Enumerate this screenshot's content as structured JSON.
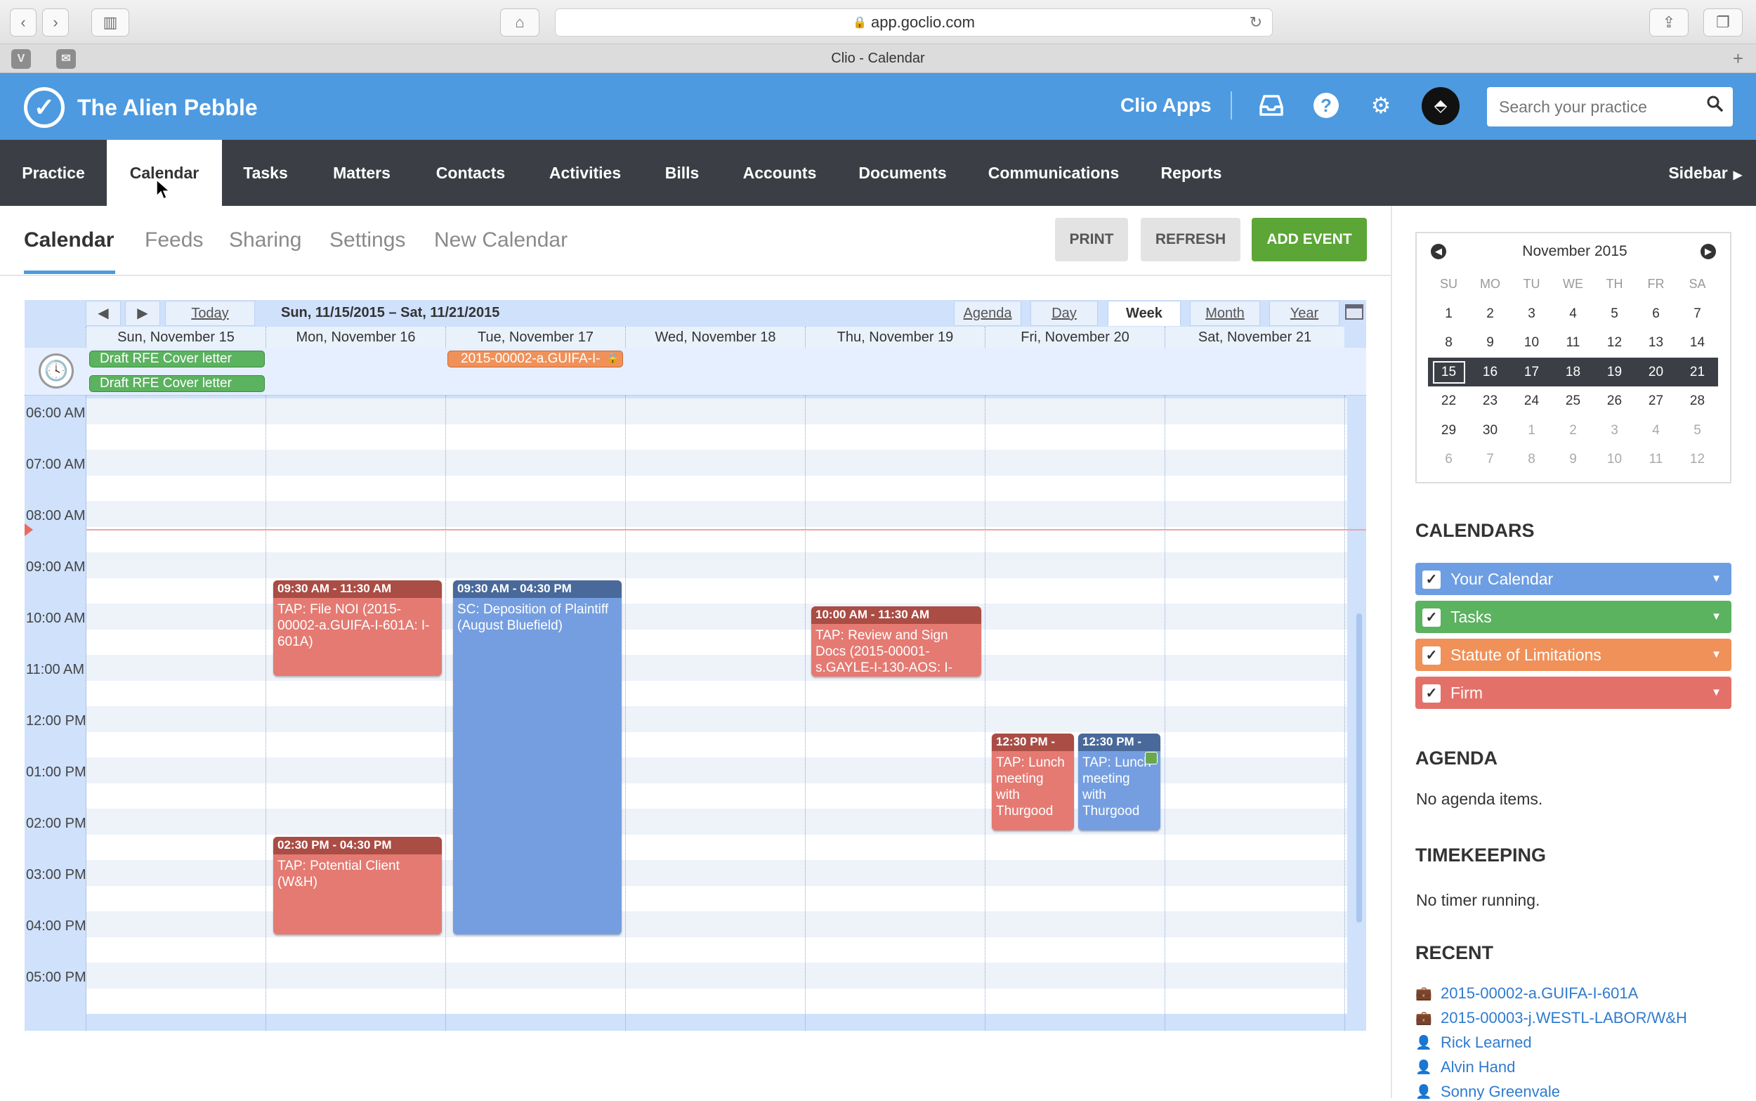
{
  "browser": {
    "url": "app.goclio.com",
    "tab_title": "Clio - Calendar",
    "pinned": [
      "V",
      "✉"
    ]
  },
  "app": {
    "firm_name": "The Alien Pebble",
    "clio_apps": "Clio Apps",
    "search_placeholder": "Search your practice"
  },
  "nav": {
    "items": [
      "Practice",
      "Calendar",
      "Tasks",
      "Matters",
      "Contacts",
      "Activities",
      "Bills",
      "Accounts",
      "Documents",
      "Communications",
      "Reports"
    ],
    "active": "Calendar",
    "sidebar": "Sidebar"
  },
  "subnav": {
    "tabs": [
      "Calendar",
      "Feeds",
      "Sharing",
      "Settings",
      "New Calendar"
    ],
    "print": "PRINT",
    "refresh": "REFRESH",
    "add_event": "ADD EVENT"
  },
  "colors": {
    "brand_blue": "#4d9ae0",
    "nav_dark": "#3b3f45",
    "add_green": "#5ba636",
    "event_red": "#e47a72",
    "event_blue": "#749ee0",
    "cal_blue": "#6d9ee3",
    "cal_green": "#5bb25f",
    "cal_orange": "#f0915a",
    "cal_red": "#e47169"
  },
  "calendar": {
    "today_btn": "Today",
    "range": "Sun, 11/15/2015 – Sat, 11/21/2015",
    "views": [
      "Agenda",
      "Day",
      "Week",
      "Month",
      "Year"
    ],
    "selected_view": "Week",
    "days": [
      "Sun, November 15",
      "Mon, November 16",
      "Tue, November 17",
      "Wed, November 18",
      "Thu, November 19",
      "Fri, November 20",
      "Sat, November 21"
    ],
    "hours": [
      "06:00 AM",
      "07:00 AM",
      "08:00 AM",
      "09:00 AM",
      "10:00 AM",
      "11:00 AM",
      "12:00 PM",
      "01:00 PM",
      "02:00 PM",
      "03:00 PM",
      "04:00 PM",
      "05:00 PM"
    ],
    "allday_events": [
      {
        "title": "Draft RFE Cover letter",
        "day": 0
      },
      {
        "title": "Draft RFE Cover letter",
        "day": 0
      },
      {
        "title": "2015-00002-a.GUIFA-I-",
        "day": 2
      }
    ],
    "events": [
      {
        "time": "09:30 AM - 11:30 AM",
        "title": "TAP: File NOI (2015-00002-a.GUIFA-I-601A: I-601A)",
        "day": 1
      },
      {
        "time": "09:30 AM - 04:30 PM",
        "title": "SC: Deposition of Plaintiff (August Bluefield)",
        "day": 2
      },
      {
        "time": "10:00 AM - 11:30 AM",
        "title": "TAP: Review and Sign Docs (2015-00001-s.GAYLE-I-130-AOS: I-",
        "day": 4
      },
      {
        "time": "02:30 PM - 04:30 PM",
        "title": "TAP: Potential Client (W&H)",
        "day": 1
      },
      {
        "time": "12:30 PM -",
        "title": "TAP: Lunch meeting with Thurgood",
        "day": 5
      },
      {
        "time": "12:30 PM -",
        "title": "TAP: Lunch meeting with Thurgood",
        "day": 5
      }
    ]
  },
  "minical": {
    "month": "November 2015",
    "dow": [
      "SU",
      "MO",
      "TU",
      "WE",
      "TH",
      "FR",
      "SA"
    ],
    "weeks": [
      [
        "1",
        "2",
        "3",
        "4",
        "5",
        "6",
        "7"
      ],
      [
        "8",
        "9",
        "10",
        "11",
        "12",
        "13",
        "14"
      ],
      [
        "15",
        "16",
        "17",
        "18",
        "19",
        "20",
        "21"
      ],
      [
        "22",
        "23",
        "24",
        "25",
        "26",
        "27",
        "28"
      ],
      [
        "29",
        "30",
        "1",
        "2",
        "3",
        "4",
        "5"
      ],
      [
        "6",
        "7",
        "8",
        "9",
        "10",
        "11",
        "12"
      ]
    ],
    "today": "15"
  },
  "sidebar": {
    "calendars_head": "CALENDARS",
    "calendars": [
      "Your Calendar",
      "Tasks",
      "Statute of Limitations",
      "Firm"
    ],
    "agenda_head": "AGENDA",
    "agenda_text": "No agenda items.",
    "timekeeping_head": "TIMEKEEPING",
    "timekeeping_text": "No timer running.",
    "recent_head": "RECENT",
    "recent": [
      {
        "label": "2015-00002-a.GUIFA-I-601A",
        "icon": "briefcase-icon"
      },
      {
        "label": "2015-00003-j.WESTL-LABOR/W&H",
        "icon": "briefcase-icon"
      },
      {
        "label": "Rick Learned",
        "icon": "person-icon"
      },
      {
        "label": "Alvin Hand",
        "icon": "person-icon"
      },
      {
        "label": "Sonny Greenvale",
        "icon": "person-icon"
      }
    ]
  }
}
